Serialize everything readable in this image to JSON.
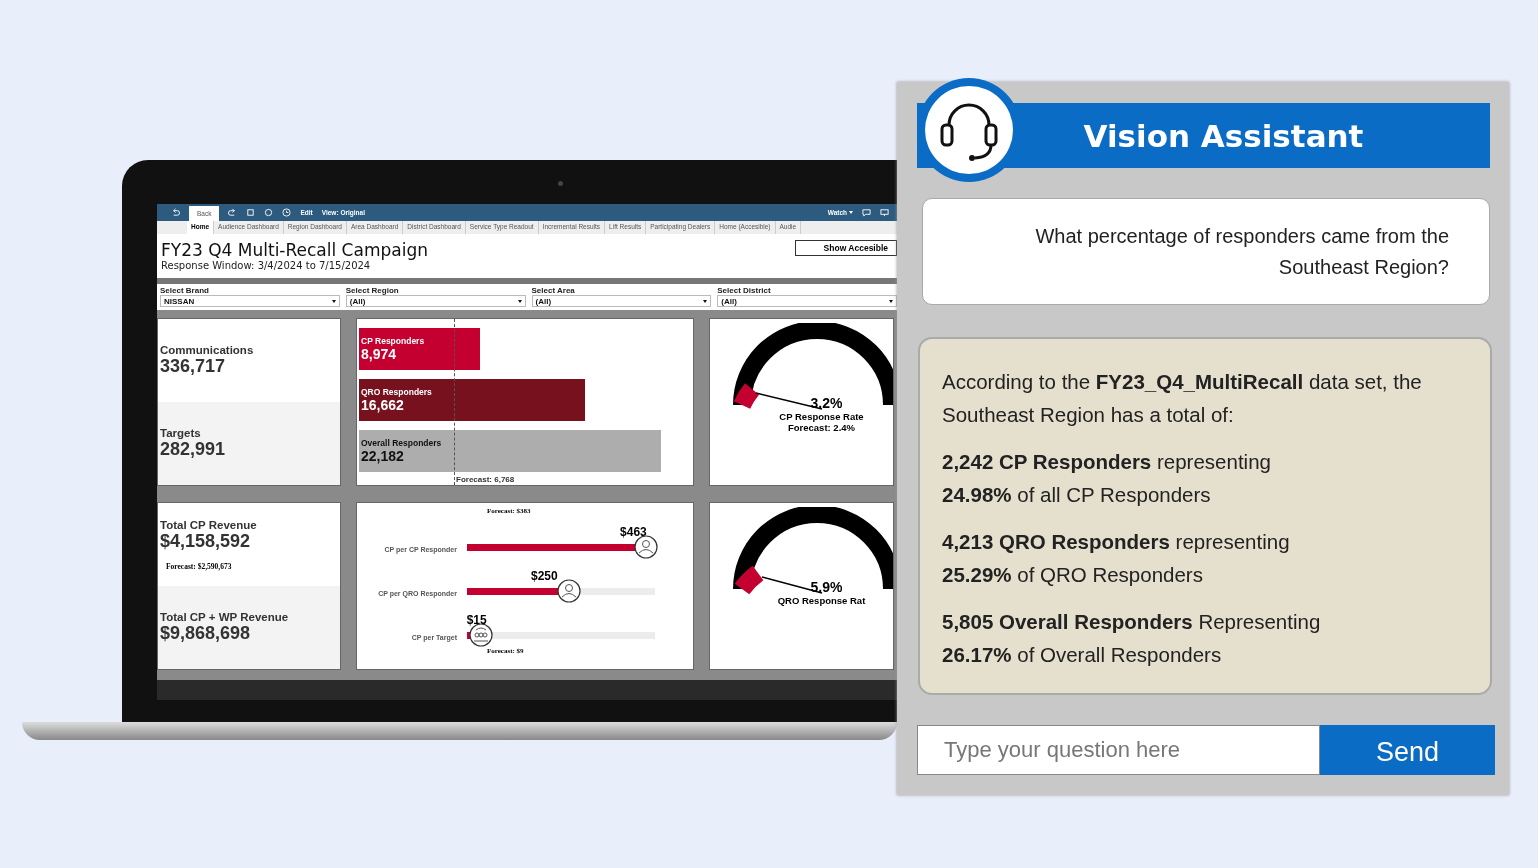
{
  "dashboard": {
    "toolbar": {
      "back": "Back",
      "edit": "Edit",
      "view": "View: Original",
      "watch": "Watch"
    },
    "tabs": [
      {
        "label": "Home",
        "selected": true
      },
      {
        "label": "Audience Dashboard",
        "selected": false
      },
      {
        "label": "Region Dashboard",
        "selected": false
      },
      {
        "label": "Area Dashboard",
        "selected": false
      },
      {
        "label": "District Dashboard",
        "selected": false
      },
      {
        "label": "Service Type Readout",
        "selected": false
      },
      {
        "label": "Incremental Results",
        "selected": false
      },
      {
        "label": "Lift Results",
        "selected": false
      },
      {
        "label": "Participating Dealers",
        "selected": false
      },
      {
        "label": "Home (Accesible)",
        "selected": false
      },
      {
        "label": "Audie",
        "selected": false
      }
    ],
    "title": "FY23 Q4 Multi-Recall Campaign",
    "subtitle": "Response Window: 3/4/2024 to 7/15/2024",
    "accessible_button": "Show Accesible",
    "filters": [
      {
        "label": "Select Brand",
        "value": "NISSAN"
      },
      {
        "label": "Select Region",
        "value": "(All)"
      },
      {
        "label": "Select Area",
        "value": "(All)"
      },
      {
        "label": "Select District",
        "value": "(All)"
      }
    ],
    "kpis": [
      {
        "label": "Communications",
        "value": "336,717"
      },
      {
        "label": "Targets",
        "value": "282,991"
      }
    ],
    "responder_bars": {
      "rows": [
        {
          "label": "CP Responders",
          "value": "8,974",
          "level": 0.38,
          "color": "#c3002f"
        },
        {
          "label": "QRO Responders",
          "value": "16,662",
          "level": 0.71,
          "color": "#76111d"
        },
        {
          "label": "Overall Responders",
          "value": "22,182",
          "level": 0.95,
          "color": "#adadad"
        }
      ],
      "forecast": "Forecast: 6,768"
    },
    "cp_gauge": {
      "value": "3.2%",
      "label": "CP Response Rate",
      "forecast": "Forecast: 2.4%"
    },
    "revenue": [
      {
        "label": "Total CP Revenue",
        "value": "$4,158,592",
        "forecast": "Forecast:  $2,590,673"
      },
      {
        "label": "Total CP + WP Revenue",
        "value": "$9,868,698"
      }
    ],
    "cost_bars": {
      "forecast_top": "Forecast:  $383",
      "rows": [
        {
          "label": "CP per CP Responder",
          "value": "$463",
          "level": 0.91,
          "kind": "person"
        },
        {
          "label": "CP per QRO Responder",
          "value": "$250",
          "level": 0.5,
          "kind": "person"
        },
        {
          "label": "CP per Target",
          "value": "$15",
          "level": 0.03,
          "kind": "group"
        }
      ],
      "forecast_bottom": "Forecast:  $9"
    },
    "qro_gauge": {
      "value": "5.9%",
      "label": "QRO Response Rat"
    }
  },
  "assistant": {
    "title": "Vision Assistant",
    "question": "What percentage of responders came from the Southeast Region?",
    "intro": "According to the **FY23_Q4_MultiRecall** data set, the Southeast Region has a total of:",
    "stats": [
      {
        "line1": "**2,242 CP Responders** representing",
        "line2": "**24.98%** of all CP Responders"
      },
      {
        "line1": "**4,213 QRO Responders** representing",
        "line2": "**25.29%** of QRO Responders"
      },
      {
        "line1": "**5,805 Overall Responders** Representing",
        "line2": "**26.17%** of Overall Responders"
      }
    ],
    "input": {
      "placeholder": "Type your question here"
    },
    "send": "Send"
  }
}
